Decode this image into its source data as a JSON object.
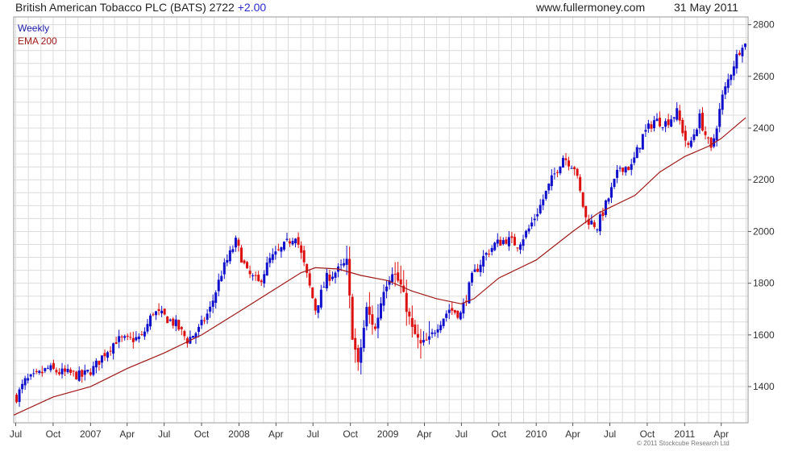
{
  "header": {
    "title": "British American Tobacco PLC (BATS) 2722",
    "change": "+2.00",
    "site": "www.fullermoney.com",
    "date": "31 May 2011"
  },
  "legend": {
    "weekly": "Weekly",
    "ema": "EMA 200"
  },
  "copyright": "© 2011 Stockcube Research Ltd",
  "colors": {
    "up": "#1010cc",
    "down": "#dd1010",
    "ema": "#a01818",
    "grid": "#dcdcdc",
    "frame": "#9a9a9a"
  },
  "chart_data": {
    "type": "candlestick",
    "title": "British American Tobacco PLC (BATS) 2722 +2.00",
    "period": "Weekly",
    "ylim": [
      1260,
      2830
    ],
    "yticks": [
      1400,
      1600,
      1800,
      2000,
      2200,
      2400,
      2600,
      2800
    ],
    "xlim": [
      "2006-06-26",
      "2011-06-06"
    ],
    "xticks": [
      {
        "label": "Jul",
        "date": "2006-07-01"
      },
      {
        "label": "Oct",
        "date": "2006-10-01"
      },
      {
        "label": "2007",
        "date": "2007-01-01"
      },
      {
        "label": "Apr",
        "date": "2007-04-01"
      },
      {
        "label": "Jul",
        "date": "2007-07-01"
      },
      {
        "label": "Oct",
        "date": "2007-10-01"
      },
      {
        "label": "2008",
        "date": "2008-01-01"
      },
      {
        "label": "Apr",
        "date": "2008-04-01"
      },
      {
        "label": "Jul",
        "date": "2008-07-01"
      },
      {
        "label": "Oct",
        "date": "2008-10-01"
      },
      {
        "label": "2009",
        "date": "2009-01-01"
      },
      {
        "label": "Apr",
        "date": "2009-04-01"
      },
      {
        "label": "Jul",
        "date": "2009-07-01"
      },
      {
        "label": "Oct",
        "date": "2009-10-01"
      },
      {
        "label": "2010",
        "date": "2010-01-01"
      },
      {
        "label": "Apr",
        "date": "2010-04-01"
      },
      {
        "label": "Jul",
        "date": "2010-07-01"
      },
      {
        "label": "Oct",
        "date": "2010-10-01"
      },
      {
        "label": "2011",
        "date": "2011-01-01"
      },
      {
        "label": "Apr",
        "date": "2011-04-01"
      }
    ],
    "close_points": [
      [
        "2006-07-03",
        1360
      ],
      [
        "2006-07-24",
        1420
      ],
      [
        "2006-08-21",
        1440
      ],
      [
        "2006-09-18",
        1470
      ],
      [
        "2006-10-16",
        1455
      ],
      [
        "2006-11-13",
        1450
      ],
      [
        "2006-12-11",
        1440
      ],
      [
        "2007-01-08",
        1470
      ],
      [
        "2007-02-05",
        1530
      ],
      [
        "2007-03-05",
        1580
      ],
      [
        "2007-04-02",
        1580
      ],
      [
        "2007-05-07",
        1590
      ],
      [
        "2007-06-04",
        1690
      ],
      [
        "2007-07-02",
        1670
      ],
      [
        "2007-07-30",
        1640
      ],
      [
        "2007-08-27",
        1580
      ],
      [
        "2007-09-24",
        1620
      ],
      [
        "2007-10-22",
        1700
      ],
      [
        "2007-11-19",
        1840
      ],
      [
        "2007-12-24",
        1960
      ],
      [
        "2008-01-21",
        1840
      ],
      [
        "2008-02-18",
        1800
      ],
      [
        "2008-03-17",
        1890
      ],
      [
        "2008-04-14",
        1930
      ],
      [
        "2008-05-19",
        1990
      ],
      [
        "2008-06-09",
        1870
      ],
      [
        "2008-07-07",
        1700
      ],
      [
        "2008-08-04",
        1820
      ],
      [
        "2008-09-01",
        1850
      ],
      [
        "2008-09-22",
        1880
      ],
      [
        "2008-10-06",
        1600
      ],
      [
        "2008-10-20",
        1480
      ],
      [
        "2008-11-10",
        1700
      ],
      [
        "2008-12-01",
        1620
      ],
      [
        "2008-12-22",
        1780
      ],
      [
        "2009-01-12",
        1850
      ],
      [
        "2009-02-02",
        1790
      ],
      [
        "2009-03-02",
        1620
      ],
      [
        "2009-03-23",
        1560
      ],
      [
        "2009-04-13",
        1580
      ],
      [
        "2009-05-04",
        1640
      ],
      [
        "2009-06-01",
        1700
      ],
      [
        "2009-06-29",
        1680
      ],
      [
        "2009-07-27",
        1820
      ],
      [
        "2009-08-24",
        1900
      ],
      [
        "2009-09-21",
        1950
      ],
      [
        "2009-10-19",
        1970
      ],
      [
        "2009-11-16",
        1950
      ],
      [
        "2009-12-14",
        2010
      ],
      [
        "2010-01-11",
        2100
      ],
      [
        "2010-02-08",
        2200
      ],
      [
        "2010-03-08",
        2290
      ],
      [
        "2010-04-05",
        2250
      ],
      [
        "2010-05-03",
        2050
      ],
      [
        "2010-05-31",
        2020
      ],
      [
        "2010-06-28",
        2130
      ],
      [
        "2010-07-26",
        2250
      ],
      [
        "2010-08-23",
        2250
      ],
      [
        "2010-09-20",
        2370
      ],
      [
        "2010-10-18",
        2430
      ],
      [
        "2010-11-15",
        2420
      ],
      [
        "2010-12-13",
        2460
      ],
      [
        "2011-01-10",
        2320
      ],
      [
        "2011-02-07",
        2440
      ],
      [
        "2011-03-07",
        2310
      ],
      [
        "2011-04-04",
        2520
      ],
      [
        "2011-05-02",
        2650
      ],
      [
        "2011-05-23",
        2730
      ],
      [
        "2011-05-31",
        2722
      ]
    ],
    "ema200_points": [
      [
        "2006-06-26",
        1290
      ],
      [
        "2006-10-01",
        1360
      ],
      [
        "2007-01-01",
        1400
      ],
      [
        "2007-04-01",
        1470
      ],
      [
        "2007-07-01",
        1530
      ],
      [
        "2007-10-01",
        1600
      ],
      [
        "2008-01-01",
        1690
      ],
      [
        "2008-04-01",
        1780
      ],
      [
        "2008-06-01",
        1840
      ],
      [
        "2008-07-07",
        1860
      ],
      [
        "2008-09-01",
        1855
      ],
      [
        "2008-10-27",
        1830
      ],
      [
        "2009-01-01",
        1810
      ],
      [
        "2009-03-01",
        1770
      ],
      [
        "2009-05-01",
        1740
      ],
      [
        "2009-07-01",
        1720
      ],
      [
        "2009-08-01",
        1740
      ],
      [
        "2009-10-01",
        1820
      ],
      [
        "2010-01-01",
        1890
      ],
      [
        "2010-04-01",
        2000
      ],
      [
        "2010-06-01",
        2070
      ],
      [
        "2010-09-01",
        2140
      ],
      [
        "2010-11-01",
        2230
      ],
      [
        "2011-01-01",
        2290
      ],
      [
        "2011-03-01",
        2330
      ],
      [
        "2011-04-01",
        2360
      ],
      [
        "2011-05-31",
        2440
      ]
    ],
    "ema200_label": "EMA 200",
    "series": [
      {
        "name": "Weekly",
        "color": "#1010cc"
      },
      {
        "name": "EMA 200",
        "color": "#a01818"
      }
    ],
    "grid": true,
    "legend": "top-left"
  }
}
